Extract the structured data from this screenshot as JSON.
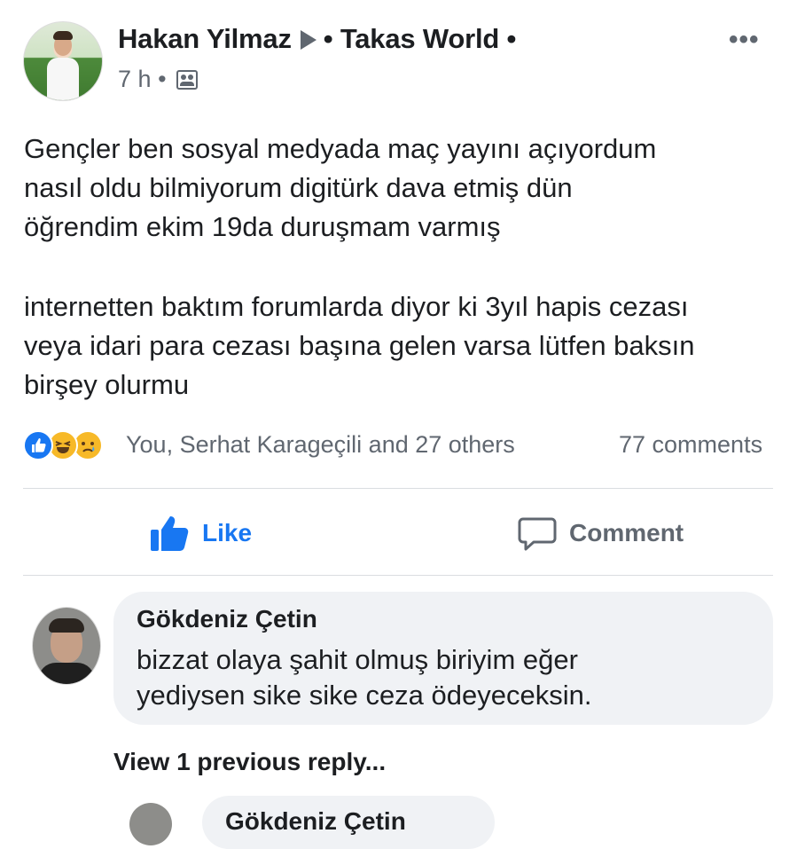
{
  "post": {
    "author": "Hakan Yilmaz",
    "group": "• Takas World •",
    "time": "7 h",
    "dot": "•",
    "more_icon": "•••",
    "text_lines_p1": [
      "Gençler ben sosyal medyada maç yayını açıyordum",
      "nasıl oldu bilmiyorum digitürk dava etmiş dün",
      "öğrendim ekim 19da duruşmam varmış"
    ],
    "text_lines_p2": [
      "internetten baktım forumlarda diyor ki 3yıl hapis cezası",
      "veya idari para cezası başına gelen varsa lütfen baksın",
      "birşey olurmu"
    ],
    "reactions_text": "You, Serhat Karageçili and 27 others",
    "comments_count": "77 comments"
  },
  "actions": {
    "like": "Like",
    "comment": "Comment"
  },
  "comment": {
    "author": "Gökdeniz Çetin",
    "text_lines": [
      "bizzat olaya şahit olmuş biriyim eğer",
      "yediysen sike sike ceza ödeyeceksin."
    ],
    "view_replies": "View 1 previous reply...",
    "reply_author_partial": "Gökdeniz Çetin"
  },
  "colors": {
    "brand_blue": "#1877f2",
    "secondary_text": "#606770",
    "bubble_bg": "#f0f2f5"
  }
}
